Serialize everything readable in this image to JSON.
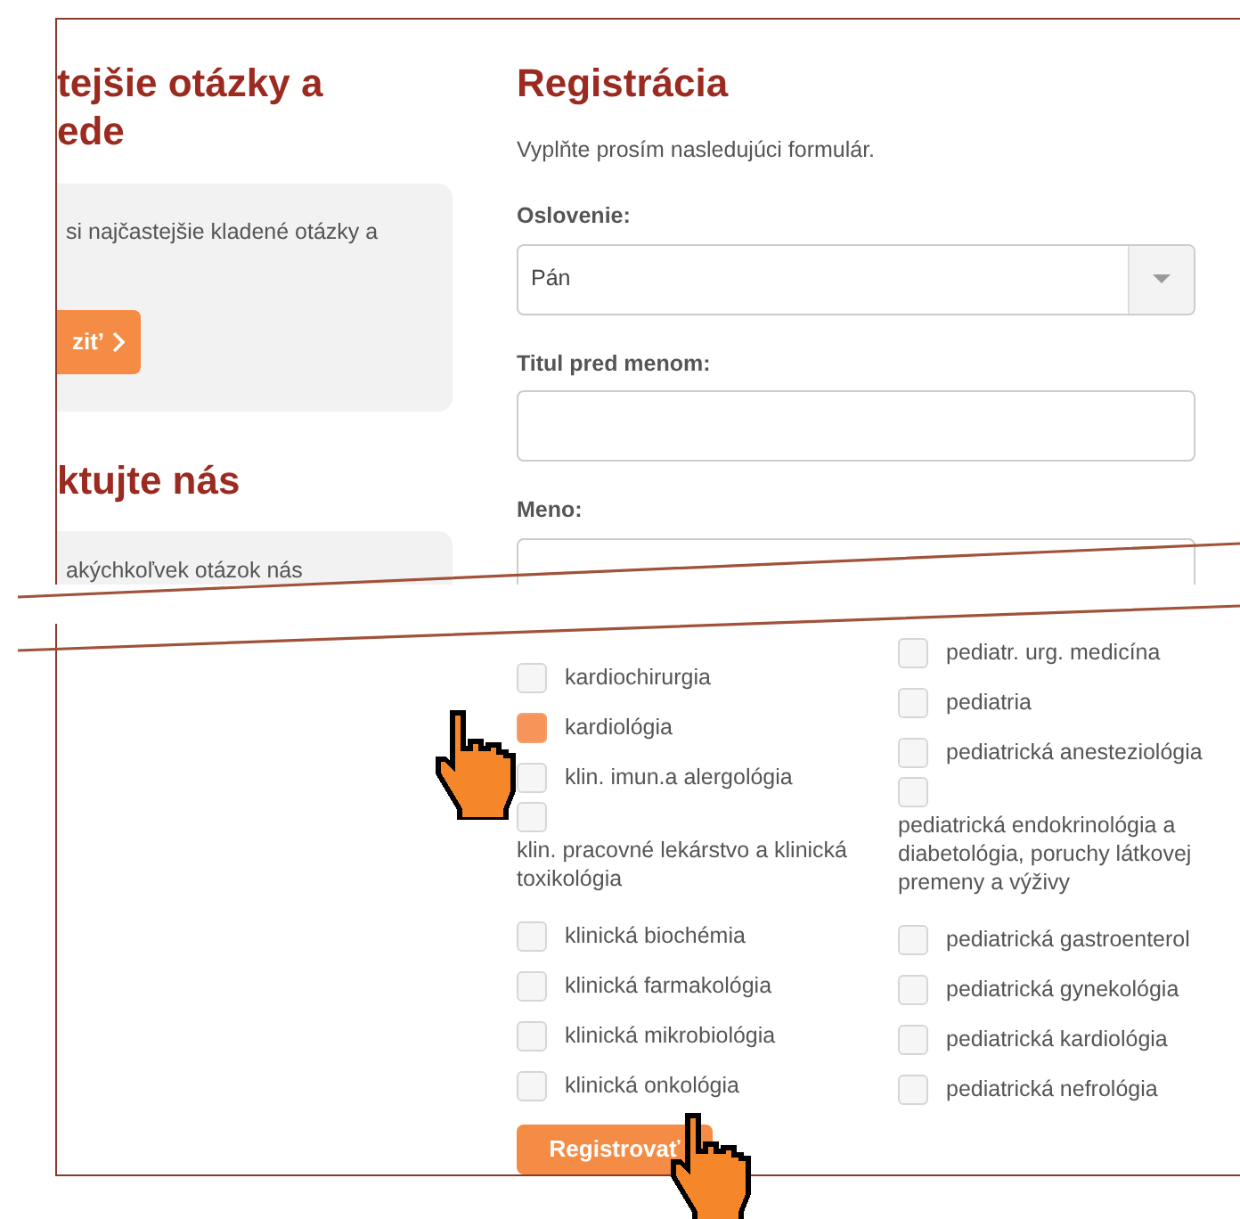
{
  "sidebar": {
    "faq": {
      "heading_lines": [
        "tejšie otázky a",
        "ede"
      ],
      "text": "si najčastejšie kladené otázky a",
      "button": "zit’"
    },
    "contact": {
      "heading": "ktujte nás",
      "text": "akýchkoľvek otázok nás"
    }
  },
  "form": {
    "title": "Registrácia",
    "intro": "Vyplňte prosím nasledujúci formulár.",
    "fields": [
      {
        "kind": "select",
        "label": "Oslovenie:",
        "value": "Pán"
      },
      {
        "kind": "text",
        "label": "Titul pred menom:"
      },
      {
        "kind": "text",
        "label": "Meno:"
      }
    ],
    "specialties": {
      "column_1": [
        {
          "kind": "inline",
          "label": "kardiochirurgia",
          "checked": false
        },
        {
          "kind": "inline",
          "label": "kardiológia",
          "checked": true
        },
        {
          "kind": "inline",
          "label": "klin. imun.a alergológia",
          "checked": false
        },
        {
          "kind": "stacked",
          "label": "klin. pracovné lekárstvo a klinická toxikológia",
          "checked": false
        },
        {
          "kind": "inline",
          "label": "klinická biochémia",
          "checked": false
        },
        {
          "kind": "inline",
          "label": "klinická farmakológia",
          "checked": false
        },
        {
          "kind": "inline",
          "label": "klinická mikrobiológia",
          "checked": false
        },
        {
          "kind": "inline",
          "label": "klinická onkológia",
          "checked": false
        }
      ],
      "column_2": [
        {
          "kind": "inline",
          "label": "pediatr. urg. medicína",
          "checked": false
        },
        {
          "kind": "inline",
          "label": "pediatria",
          "checked": false
        },
        {
          "kind": "inline",
          "label": "pediatrická anesteziológia",
          "checked": false
        },
        {
          "kind": "stacked",
          "label": "pediatrická endokrinológia a diabetológia, poruchy látkovej premeny a výživy",
          "checked": false
        },
        {
          "kind": "inline",
          "label": "pediatrická gastroenterol",
          "checked": false
        },
        {
          "kind": "inline",
          "label": "pediatrická gynekológia",
          "checked": false
        },
        {
          "kind": "inline",
          "label": "pediatrická kardiológia",
          "checked": false
        },
        {
          "kind": "inline",
          "label": "pediatrická nefrológia",
          "checked": false
        }
      ]
    },
    "submit": "Registrovať"
  }
}
